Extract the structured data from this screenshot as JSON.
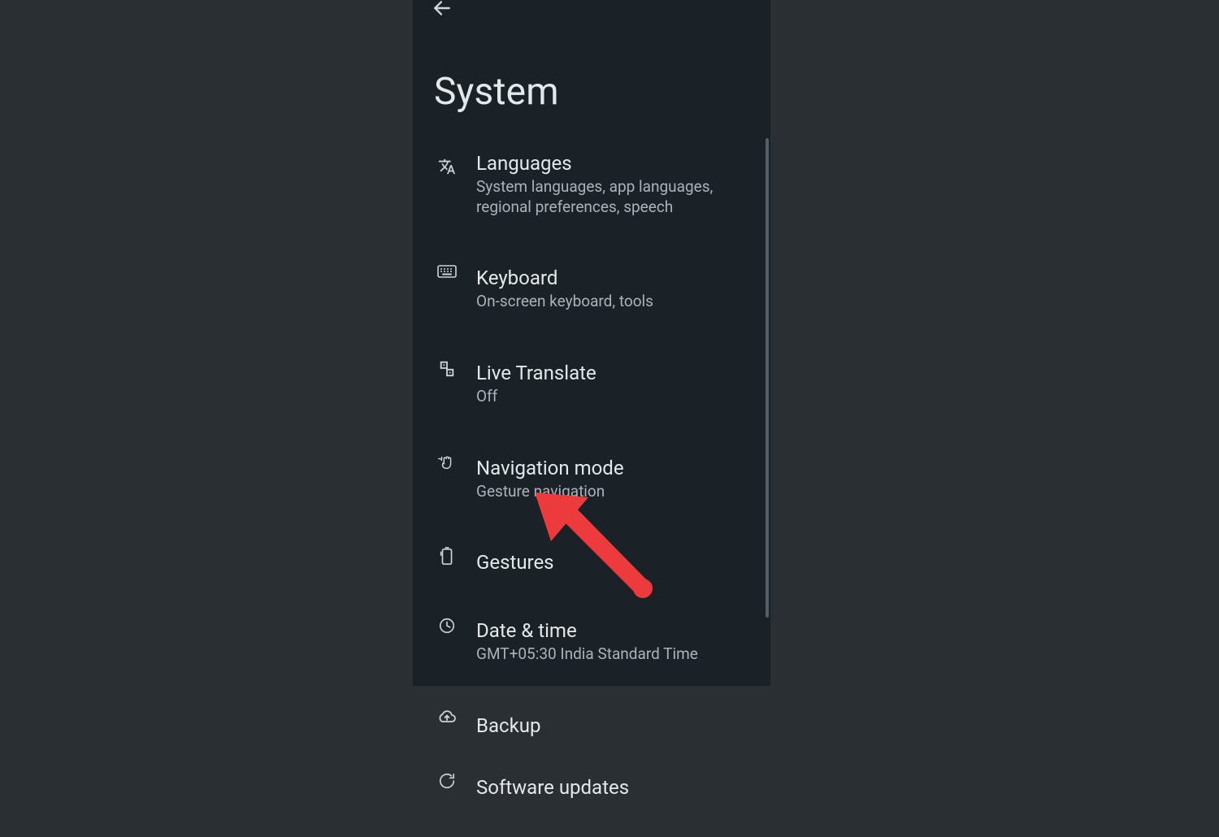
{
  "header": {
    "title": "System"
  },
  "items": [
    {
      "icon": "languages",
      "title": "Languages",
      "sub": "System languages, app languages, regional preferences, speech"
    },
    {
      "icon": "keyboard",
      "title": "Keyboard",
      "sub": "On-screen keyboard, tools"
    },
    {
      "icon": "translate",
      "title": "Live Translate",
      "sub": "Off"
    },
    {
      "icon": "hand",
      "title": "Navigation mode",
      "sub": "Gesture navigation"
    },
    {
      "icon": "phone-gesture",
      "title": "Gestures",
      "sub": ""
    },
    {
      "icon": "clock",
      "title": "Date & time",
      "sub": "GMT+05:30 India Standard Time"
    },
    {
      "icon": "cloud",
      "title": "Backup",
      "sub": ""
    },
    {
      "icon": "update",
      "title": "Software updates",
      "sub": ""
    }
  ],
  "annotation": {
    "arrow_color": "#ed3a3d",
    "points_to_item": "Gestures"
  }
}
